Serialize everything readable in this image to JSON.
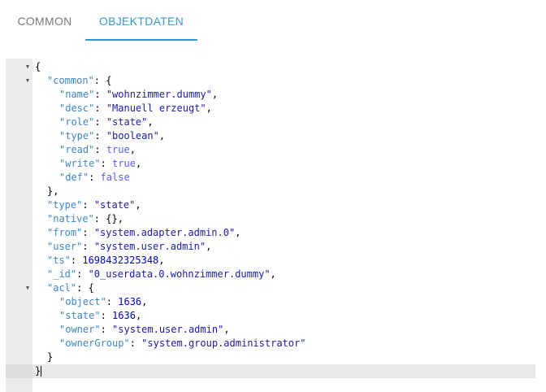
{
  "tabs": {
    "common": "COMMON",
    "objektdaten": "OBJEKTDATEN"
  },
  "editor": {
    "lines": [
      {
        "indent": 0,
        "key": "",
        "value": "",
        "vtype": "",
        "punct": "{",
        "fold": true
      },
      {
        "indent": 1,
        "key": "\"common\"",
        "value": "",
        "vtype": "",
        "punct": ": {",
        "fold": true
      },
      {
        "indent": 2,
        "key": "\"name\"",
        "value": "\"wohnzimmer.dummy\"",
        "vtype": "s",
        "punct": ",",
        "fold": false
      },
      {
        "indent": 2,
        "key": "\"desc\"",
        "value": "\"Manuell erzeugt\"",
        "vtype": "s",
        "punct": ",",
        "fold": false
      },
      {
        "indent": 2,
        "key": "\"role\"",
        "value": "\"state\"",
        "vtype": "s",
        "punct": ",",
        "fold": false
      },
      {
        "indent": 2,
        "key": "\"type\"",
        "value": "\"boolean\"",
        "vtype": "s",
        "punct": ",",
        "fold": false
      },
      {
        "indent": 2,
        "key": "\"read\"",
        "value": "true",
        "vtype": "b",
        "punct": ",",
        "fold": false
      },
      {
        "indent": 2,
        "key": "\"write\"",
        "value": "true",
        "vtype": "b",
        "punct": ",",
        "fold": false
      },
      {
        "indent": 2,
        "key": "\"def\"",
        "value": "false",
        "vtype": "b",
        "punct": "",
        "fold": false
      },
      {
        "indent": 1,
        "key": "",
        "value": "",
        "vtype": "",
        "punct": "},",
        "fold": false
      },
      {
        "indent": 1,
        "key": "\"type\"",
        "value": "\"state\"",
        "vtype": "s",
        "punct": ",",
        "fold": false
      },
      {
        "indent": 1,
        "key": "\"native\"",
        "value": "",
        "vtype": "",
        "punct": ": {},",
        "fold": false
      },
      {
        "indent": 1,
        "key": "\"from\"",
        "value": "\"system.adapter.admin.0\"",
        "vtype": "s",
        "punct": ",",
        "fold": false
      },
      {
        "indent": 1,
        "key": "\"user\"",
        "value": "\"system.user.admin\"",
        "vtype": "s",
        "punct": ",",
        "fold": false
      },
      {
        "indent": 1,
        "key": "\"ts\"",
        "value": "1698432325348",
        "vtype": "n",
        "punct": ",",
        "fold": false
      },
      {
        "indent": 1,
        "key": "\"_id\"",
        "value": "\"0_userdata.0.wohnzimmer.dummy\"",
        "vtype": "s",
        "punct": ",",
        "fold": false
      },
      {
        "indent": 1,
        "key": "\"acl\"",
        "value": "",
        "vtype": "",
        "punct": ": {",
        "fold": true
      },
      {
        "indent": 2,
        "key": "\"object\"",
        "value": "1636",
        "vtype": "n",
        "punct": ",",
        "fold": false
      },
      {
        "indent": 2,
        "key": "\"state\"",
        "value": "1636",
        "vtype": "n",
        "punct": ",",
        "fold": false
      },
      {
        "indent": 2,
        "key": "\"owner\"",
        "value": "\"system.user.admin\"",
        "vtype": "s",
        "punct": ",",
        "fold": false
      },
      {
        "indent": 2,
        "key": "\"ownerGroup\"",
        "value": "\"system.group.administrator\"",
        "vtype": "s",
        "punct": "",
        "fold": false
      },
      {
        "indent": 1,
        "key": "",
        "value": "",
        "vtype": "",
        "punct": "}",
        "fold": false
      },
      {
        "indent": 0,
        "key": "",
        "value": "",
        "vtype": "",
        "punct": "}",
        "fold": false,
        "active": true
      }
    ]
  },
  "icons": {
    "fold": "fold-arrow-down-icon"
  }
}
